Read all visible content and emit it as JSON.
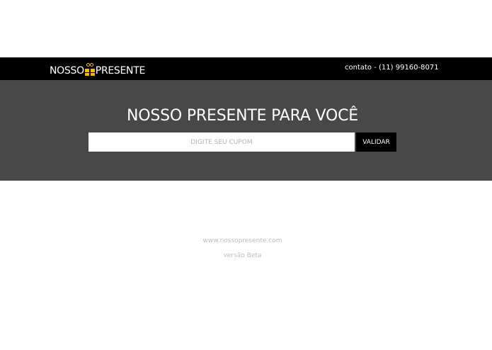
{
  "header": {
    "logo_left": "NOSSO",
    "logo_icon": "gift-icon",
    "logo_right": "PRESENTE",
    "contact": "contato - (11) 99160-8071"
  },
  "hero": {
    "title": "NOSSO PRESENTE PARA VOCÊ",
    "coupon_placeholder": "DIGITE SEU CUPOM",
    "coupon_value": "",
    "validate_label": "VALIDAR"
  },
  "footer": {
    "site": "www.nossopresente.com",
    "version": "versão Beta"
  },
  "colors": {
    "header_bg": "#000000",
    "hero_bg": "#484848",
    "accent": "#f2b705",
    "footer_text": "#bdbdbd"
  }
}
